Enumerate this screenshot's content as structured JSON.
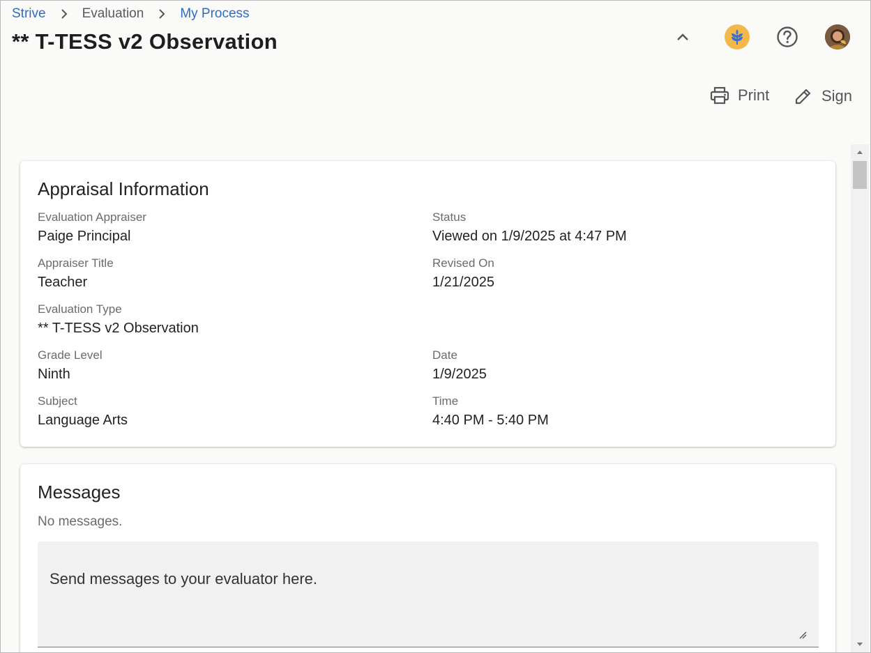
{
  "breadcrumb": {
    "items": [
      {
        "label": "Strive",
        "link": true
      },
      {
        "label": "Evaluation",
        "link": false
      },
      {
        "label": "My Process",
        "link": true
      }
    ]
  },
  "page_title": "** T-TESS v2 Observation",
  "header_icons": [
    "chevron-up-icon",
    "logo-icon",
    "help-icon",
    "avatar"
  ],
  "actions": {
    "print_label": "Print",
    "sign_label": "Sign"
  },
  "appraisal": {
    "title": "Appraisal Information",
    "fields": {
      "appraiser": {
        "label": "Evaluation Appraiser",
        "value": "Paige Principal"
      },
      "status": {
        "label": "Status",
        "value": "Viewed on 1/9/2025 at 4:47 PM"
      },
      "appraiser_title": {
        "label": "Appraiser Title",
        "value": "Teacher"
      },
      "revised_on": {
        "label": "Revised On",
        "value": "1/21/2025"
      },
      "evaluation_type": {
        "label": "Evaluation Type",
        "value": "** T-TESS v2 Observation"
      },
      "grade_level": {
        "label": "Grade Level",
        "value": "Ninth"
      },
      "date": {
        "label": "Date",
        "value": "1/9/2025"
      },
      "subject": {
        "label": "Subject",
        "value": "Language Arts"
      },
      "time": {
        "label": "Time",
        "value": "4:40 PM - 5:40 PM"
      }
    }
  },
  "messages": {
    "title": "Messages",
    "empty_text": "No messages.",
    "input_placeholder": "Send messages to your evaluator here."
  },
  "colors": {
    "link": "#2e6bc4",
    "background": "#fafaf8",
    "logo_bg": "#f2b94a",
    "logo_fg": "#3a6fd0"
  }
}
